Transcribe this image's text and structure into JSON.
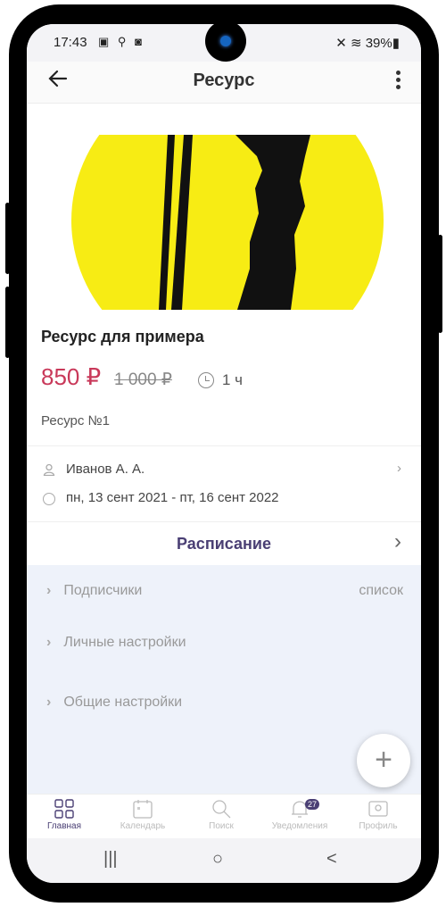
{
  "status": {
    "time": "17:43",
    "icons": [
      "image-icon",
      "search-icon",
      "square-icon"
    ],
    "battery": "39%"
  },
  "appbar": {
    "title": "Ресурс",
    "back_icon": "arrow-left-icon",
    "menu_icon": "more-vertical-icon"
  },
  "resource": {
    "name": "Ресурс для примера",
    "price": "850 ₽",
    "old_price": "1 000 ₽",
    "duration": "1 ч",
    "number": "Ресурс №1",
    "owner": "Иванов А. А.",
    "period": "пн, 13 сент 2021 - пт, 16 сент 2022"
  },
  "schedule": {
    "label": "Расписание"
  },
  "settings": [
    {
      "label": "Подписчики",
      "value": "список"
    },
    {
      "label": "Личные настройки",
      "value": ""
    },
    {
      "label": "Общие настройки",
      "value": ""
    }
  ],
  "fab": {
    "label": "+"
  },
  "tabs": [
    {
      "label": "Главная",
      "icon": "grid-icon",
      "active": true
    },
    {
      "label": "Календарь",
      "icon": "calendar-icon",
      "active": false
    },
    {
      "label": "Поиск",
      "icon": "search-icon",
      "active": false
    },
    {
      "label": "Уведомления",
      "icon": "bell-icon",
      "badge": "27",
      "active": false
    },
    {
      "label": "Профиль",
      "icon": "profile-icon",
      "active": false
    }
  ],
  "navbar": {
    "recents": "|||",
    "home": "○",
    "back": "<"
  },
  "colors": {
    "accent": "#4a3f74",
    "price": "#c9395a",
    "hero_yellow": "#f7ec14",
    "settings_bg": "#eef2fa"
  }
}
